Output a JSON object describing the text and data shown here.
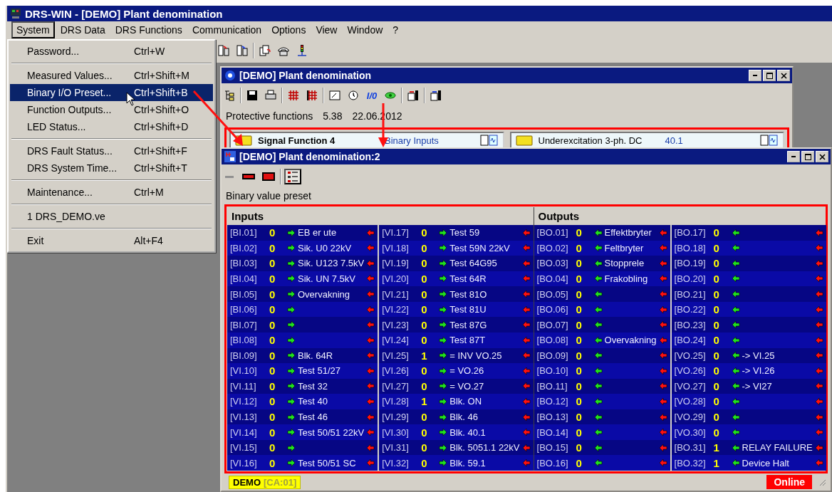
{
  "window": {
    "title": "DRS-WIN - [DEMO]  Plant denomination"
  },
  "menu_bar": [
    {
      "label": "System",
      "selected": true
    },
    {
      "label": "DRS Data",
      "selected": false
    },
    {
      "label": "DRS Functions",
      "selected": false
    },
    {
      "label": "Communication",
      "selected": false
    },
    {
      "label": "Options",
      "selected": false
    },
    {
      "label": "View",
      "selected": false
    },
    {
      "label": "Window",
      "selected": false
    },
    {
      "label": "?",
      "selected": false
    }
  ],
  "system_menu": [
    [
      {
        "label": "Password...",
        "shortcut": "Ctrl+W",
        "selected": false
      }
    ],
    [
      {
        "label": "Measured Values...",
        "shortcut": "Ctrl+Shift+M",
        "selected": false
      },
      {
        "label": "Binary I/O Preset...",
        "shortcut": "Ctrl+Shift+B",
        "selected": true
      },
      {
        "label": "Function Outputs...",
        "shortcut": "Ctrl+Shift+O",
        "selected": false
      },
      {
        "label": "LED Status...",
        "shortcut": "Ctrl+Shift+D",
        "selected": false
      }
    ],
    [
      {
        "label": "DRS Fault Status...",
        "shortcut": "Ctrl+Shift+F",
        "selected": false
      },
      {
        "label": "DRS System Time...",
        "shortcut": "Ctrl+Shift+T",
        "selected": false
      }
    ],
    [
      {
        "label": "Maintenance...",
        "shortcut": "Ctrl+M",
        "selected": false
      }
    ],
    [
      {
        "label": "1 DRS_DEMO.ve",
        "selected": false
      }
    ],
    [
      {
        "label": "Exit",
        "shortcut": "Alt+F4",
        "selected": false
      }
    ]
  ],
  "plant_window": {
    "title": "[DEMO]  Plant denomination",
    "toolbar_label": "I/0",
    "info": [
      "Protective functions",
      "5.38",
      "22.06.2012"
    ],
    "functions": [
      {
        "name": "Signal Function 4",
        "category": "Binary Inputs",
        "selected": true
      },
      {
        "name": "Underexcitation 3-ph. DC",
        "category": "40.1",
        "selected": false
      }
    ]
  },
  "preset_window": {
    "title": "[DEMO]  Plant denomination:2",
    "caption": "Binary value preset",
    "view_buttons": [
      {
        "kind": "dash",
        "selected": false
      },
      {
        "kind": "led-small",
        "selected": false
      },
      {
        "kind": "led-large",
        "selected": false
      },
      {
        "kind": "list",
        "selected": true
      }
    ],
    "sections": [
      {
        "title": "Inputs",
        "kind": "input",
        "columns": [
          [
            {
              "code": "[BI.01]",
              "value": "0",
              "name": "EB er ute"
            },
            {
              "code": "[BI.02]",
              "value": "0",
              "name": "Sik. U0 22kV"
            },
            {
              "code": "[BI.03]",
              "value": "0",
              "name": "Sik. U123 7.5kV"
            },
            {
              "code": "[BI.04]",
              "value": "0",
              "name": "Sik. UN 7.5kV"
            },
            {
              "code": "[BI.05]",
              "value": "0",
              "name": "Overvakning"
            },
            {
              "code": "[BI.06]",
              "value": "0"
            },
            {
              "code": "[BI.07]",
              "value": "0"
            },
            {
              "code": "[BI.08]",
              "value": "0"
            },
            {
              "code": "[BI.09]",
              "value": "0",
              "name": "Blk. 64R"
            },
            {
              "code": "[VI.10]",
              "value": "0",
              "name": "Test 51/27"
            },
            {
              "code": "[VI.11]",
              "value": "0",
              "name": "Test 32"
            },
            {
              "code": "[VI.12]",
              "value": "0",
              "name": "Test 40"
            },
            {
              "code": "[VI.13]",
              "value": "0",
              "name": "Test 46"
            },
            {
              "code": "[VI.14]",
              "value": "0",
              "name": "Test 50/51 22kV"
            },
            {
              "code": "[VI.15]",
              "value": "0"
            },
            {
              "code": "[VI.16]",
              "value": "0",
              "name": "Test 50/51 SC"
            }
          ],
          [
            {
              "code": "[VI.17]",
              "value": "0",
              "name": "Test 59"
            },
            {
              "code": "[VI.18]",
              "value": "0",
              "name": "Test 59N 22kV"
            },
            {
              "code": "[VI.19]",
              "value": "0",
              "name": "Test 64G95"
            },
            {
              "code": "[VI.20]",
              "value": "0",
              "name": "Test 64R"
            },
            {
              "code": "[VI.21]",
              "value": "0",
              "name": "Test 81O"
            },
            {
              "code": "[VI.22]",
              "value": "0",
              "name": "Test 81U"
            },
            {
              "code": "[VI.23]",
              "value": "0",
              "name": "Test 87G"
            },
            {
              "code": "[VI.24]",
              "value": "0",
              "name": "Test 87T"
            },
            {
              "code": "[VI.25]",
              "value": "1",
              "name": "= INV VO.25"
            },
            {
              "code": "[VI.26]",
              "value": "0",
              "name": "= VO.26"
            },
            {
              "code": "[VI.27]",
              "value": "0",
              "name": "= VO.27"
            },
            {
              "code": "[VI.28]",
              "value": "1",
              "name": "Blk. ON"
            },
            {
              "code": "[VI.29]",
              "value": "0",
              "name": "Blk. 46"
            },
            {
              "code": "[VI.30]",
              "value": "0",
              "name": "Blk. 40.1"
            },
            {
              "code": "[VI.31]",
              "value": "0",
              "name": "Blk. 5051.1 22kV"
            },
            {
              "code": "[VI.32]",
              "value": "0",
              "name": "Blk. 59.1"
            }
          ]
        ]
      },
      {
        "title": "Outputs",
        "kind": "output",
        "columns": [
          [
            {
              "code": "[BO.01]",
              "value": "0",
              "name": "Effektbryter"
            },
            {
              "code": "[BO.02]",
              "value": "0",
              "name": "Feltbryter"
            },
            {
              "code": "[BO.03]",
              "value": "0",
              "name": "Stopprele"
            },
            {
              "code": "[BO.04]",
              "value": "0",
              "name": "Frakobling"
            },
            {
              "code": "[BO.05]",
              "value": "0"
            },
            {
              "code": "[BO.06]",
              "value": "0"
            },
            {
              "code": "[BO.07]",
              "value": "0"
            },
            {
              "code": "[BO.08]",
              "value": "0",
              "name": "Overvakning"
            },
            {
              "code": "[BO.09]",
              "value": "0"
            },
            {
              "code": "[BO.10]",
              "value": "0"
            },
            {
              "code": "[BO.11]",
              "value": "0"
            },
            {
              "code": "[BO.12]",
              "value": "0"
            },
            {
              "code": "[BO.13]",
              "value": "0"
            },
            {
              "code": "[BO.14]",
              "value": "0"
            },
            {
              "code": "[BO.15]",
              "value": "0"
            },
            {
              "code": "[BO.16]",
              "value": "0"
            }
          ],
          [
            {
              "code": "[BO.17]",
              "value": "0"
            },
            {
              "code": "[BO.18]",
              "value": "0"
            },
            {
              "code": "[BO.19]",
              "value": "0"
            },
            {
              "code": "[BO.20]",
              "value": "0"
            },
            {
              "code": "[BO.21]",
              "value": "0"
            },
            {
              "code": "[BO.22]",
              "value": "0"
            },
            {
              "code": "[BO.23]",
              "value": "0"
            },
            {
              "code": "[BO.24]",
              "value": "0"
            },
            {
              "code": "[VO.25]",
              "value": "0",
              "name": "-> VI.25"
            },
            {
              "code": "[VO.26]",
              "value": "0",
              "name": "-> VI.26"
            },
            {
              "code": "[VO.27]",
              "value": "0",
              "name": "-> VI27"
            },
            {
              "code": "[VO.28]",
              "value": "0"
            },
            {
              "code": "[VO.29]",
              "value": "0"
            },
            {
              "code": "[VO.30]",
              "value": "0"
            },
            {
              "code": "[BO.31]",
              "value": "1",
              "name": "RELAY FAILURE"
            },
            {
              "code": "[BO.32]",
              "value": "1",
              "name": "Device Halt"
            }
          ]
        ]
      }
    ],
    "status_bar": {
      "device": "DEMO",
      "address": "[CA:01]",
      "connection": "Online"
    }
  }
}
